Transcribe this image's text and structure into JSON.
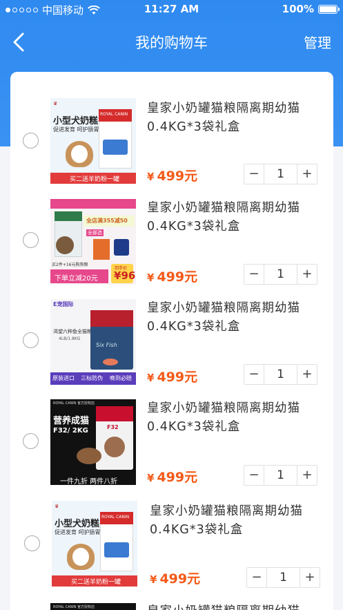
{
  "status": {
    "carrier": "中国移动",
    "time": "11:27 AM",
    "battery": "100%"
  },
  "nav": {
    "title": "我的购物车",
    "manage": "管理"
  },
  "items": [
    {
      "title": "皇家小奶罐猫粮隔离期幼猫0.4KG*3袋礼盒",
      "price_symbol": "¥",
      "price": "499元",
      "qty": "1",
      "minus": "−",
      "plus": "+",
      "thumb": {
        "headline": "小型犬奶糕",
        "sub": "促进发育 呵护肠胃",
        "weight": "1kg",
        "brand": "ROYAL CANIN",
        "banner": "买二送羊奶粉一罐"
      }
    },
    {
      "title": "皇家小奶罐猫粮隔离期幼猫0.4KG*3袋礼盒",
      "price_symbol": "¥",
      "price": "499元",
      "qty": "1",
      "minus": "−",
      "plus": "+",
      "thumb": {
        "promo1": "全店满355减50",
        "promo2": "全部选",
        "banner": "下单立减20元",
        "price_tag": "96",
        "price_label": "到手价",
        "sub": "买2件+16元购狗粮"
      }
    },
    {
      "title": "皇家小奶罐猫粮隔离期幼猫0.4KG*3袋礼盒",
      "price_symbol": "¥",
      "price": "499元",
      "qty": "1",
      "minus": "−",
      "plus": "+",
      "thumb": {
        "store": "E宠国际",
        "headline": "渴望六种鱼全猫粮",
        "weight": "4LB/1.8KG",
        "tag1": "原装进口",
        "tag2": "三标防伪",
        "tag3": "晚到必赔",
        "bag": "Six Fish"
      }
    },
    {
      "title": "皇家小奶罐猫粮隔离期幼猫0.4KG*3袋礼盒",
      "price_symbol": "¥",
      "price": "499元",
      "qty": "1",
      "minus": "−",
      "plus": "+",
      "thumb": {
        "store": "ROYAL CANIN 官方授权店",
        "headline": "营养成猫",
        "code": "F32/ 2KG",
        "banner": "一件九折 两件八折",
        "bag": "F32"
      }
    },
    {
      "title": "皇家小奶罐猫粮隔离期幼猫0.4KG*3袋礼盒",
      "price_symbol": "¥",
      "price": "499元",
      "qty": "1",
      "minus": "−",
      "plus": "+",
      "thumb": {
        "headline": "小型犬奶糕",
        "sub": "促进发育 呵护肠胃",
        "weight": "1kg",
        "brand": "ROYAL CANIN",
        "banner": "买二送羊奶粉一罐"
      }
    },
    {
      "title": "皇家小奶罐猫粮隔离期幼猫",
      "thumb": {
        "store": "ROYAL CANIN 官方授权店"
      }
    }
  ]
}
